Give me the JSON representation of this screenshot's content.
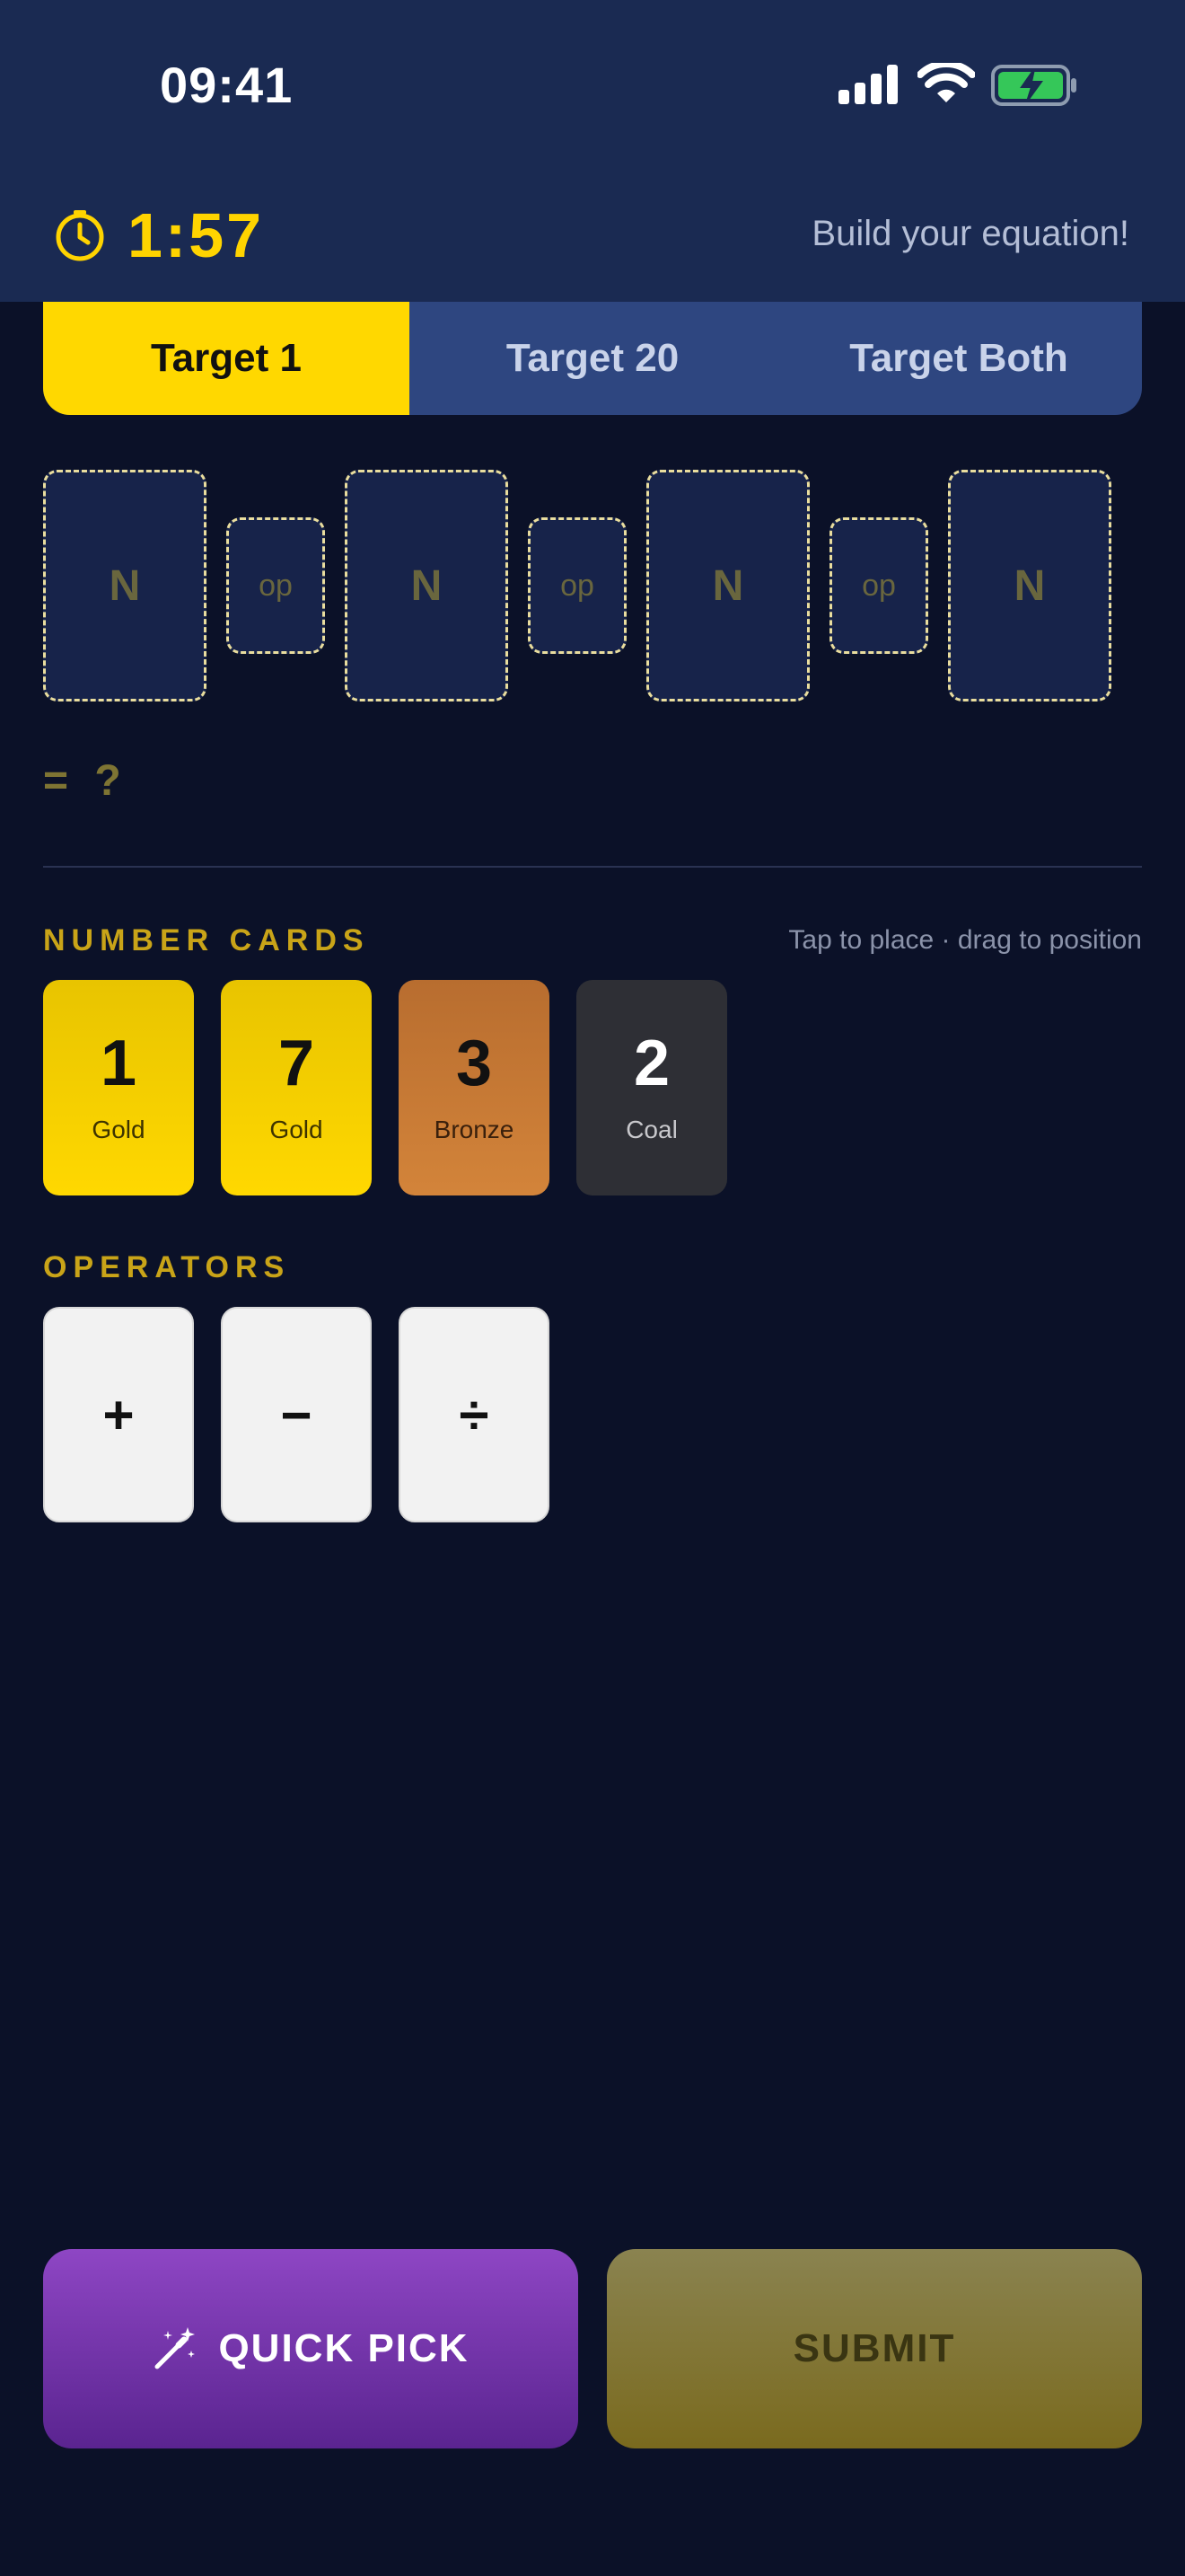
{
  "status_bar": {
    "time": "09:41"
  },
  "header": {
    "timer": "1:57",
    "hint": "Build your equation!"
  },
  "tabs": [
    {
      "label": "Target 1",
      "active": true
    },
    {
      "label": "Target 20",
      "active": false
    },
    {
      "label": "Target Both",
      "active": false
    }
  ],
  "equation": {
    "slots": [
      "N",
      "op",
      "N",
      "op",
      "N",
      "op",
      "N"
    ],
    "result": "= ?"
  },
  "number_cards": {
    "title": "NUMBER CARDS",
    "hint": "Tap to place · drag to position",
    "cards": [
      {
        "value": "1",
        "tier": "Gold"
      },
      {
        "value": "7",
        "tier": "Gold"
      },
      {
        "value": "3",
        "tier": "Bronze"
      },
      {
        "value": "2",
        "tier": "Coal"
      }
    ]
  },
  "operators": {
    "title": "OPERATORS",
    "items": [
      "+",
      "−",
      "÷"
    ]
  },
  "buttons": {
    "quick_pick": "QUICK PICK",
    "submit": "SUBMIT"
  },
  "colors": {
    "accent": "#ffd800",
    "background": "#0b1128",
    "header": "#1a2a52",
    "gold": "#ffd800",
    "bronze": "#d3843a",
    "coal": "#2e2f35",
    "quick_pick": "#7a36b0"
  },
  "icons": [
    "signal-icon",
    "wifi-icon",
    "battery-charging-icon",
    "timer-icon",
    "magic-wand-icon"
  ]
}
